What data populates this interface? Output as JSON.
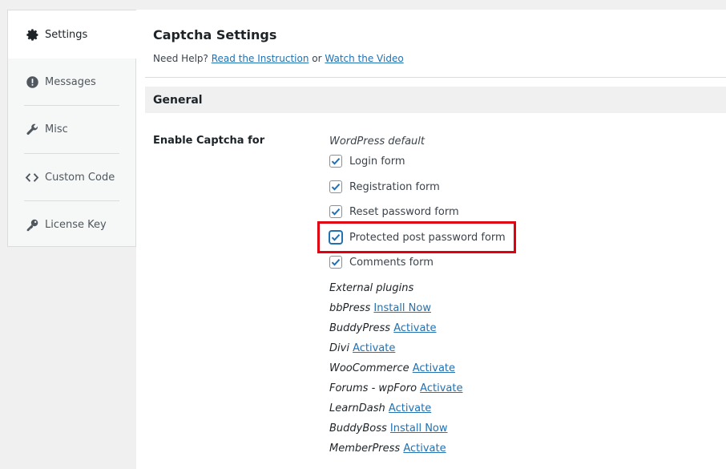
{
  "sidebar": {
    "items": [
      {
        "label": "Settings",
        "icon": "gear-icon",
        "active": true
      },
      {
        "label": "Messages",
        "icon": "alert-icon"
      },
      {
        "label": "Misc",
        "icon": "wrench-icon"
      },
      {
        "label": "Custom Code",
        "icon": "code-icon"
      },
      {
        "label": "License Key",
        "icon": "key-icon"
      }
    ]
  },
  "header": {
    "title": "Captcha Settings",
    "help_prefix": "Need Help?",
    "instruction_link": "Read the Instruction",
    "or_text": "or",
    "video_link": "Watch the Video"
  },
  "section": {
    "title": "General"
  },
  "enable": {
    "label": "Enable Captcha for",
    "wp_heading": "WordPress default",
    "wp_forms": [
      {
        "label": "Login form",
        "checked": true
      },
      {
        "label": "Registration form",
        "checked": true
      },
      {
        "label": "Reset password form",
        "checked": true
      },
      {
        "label": "Protected post password form",
        "checked": true,
        "highlighted": true
      },
      {
        "label": "Comments form",
        "checked": true
      }
    ],
    "ext_heading": "External plugins",
    "plugins": [
      {
        "name": "bbPress",
        "action": "Install Now"
      },
      {
        "name": "BuddyPress",
        "action": "Activate"
      },
      {
        "name": "Divi",
        "action": "Activate"
      },
      {
        "name": "WooCommerce",
        "action": "Activate"
      },
      {
        "name": "Forums - wpForo",
        "action": "Activate"
      },
      {
        "name": "LearnDash",
        "action": "Activate"
      },
      {
        "name": "BuddyBoss",
        "action": "Install Now"
      },
      {
        "name": "MemberPress",
        "action": "Activate"
      }
    ]
  },
  "colors": {
    "accent": "#2271b1",
    "highlight": "#e0000f"
  }
}
